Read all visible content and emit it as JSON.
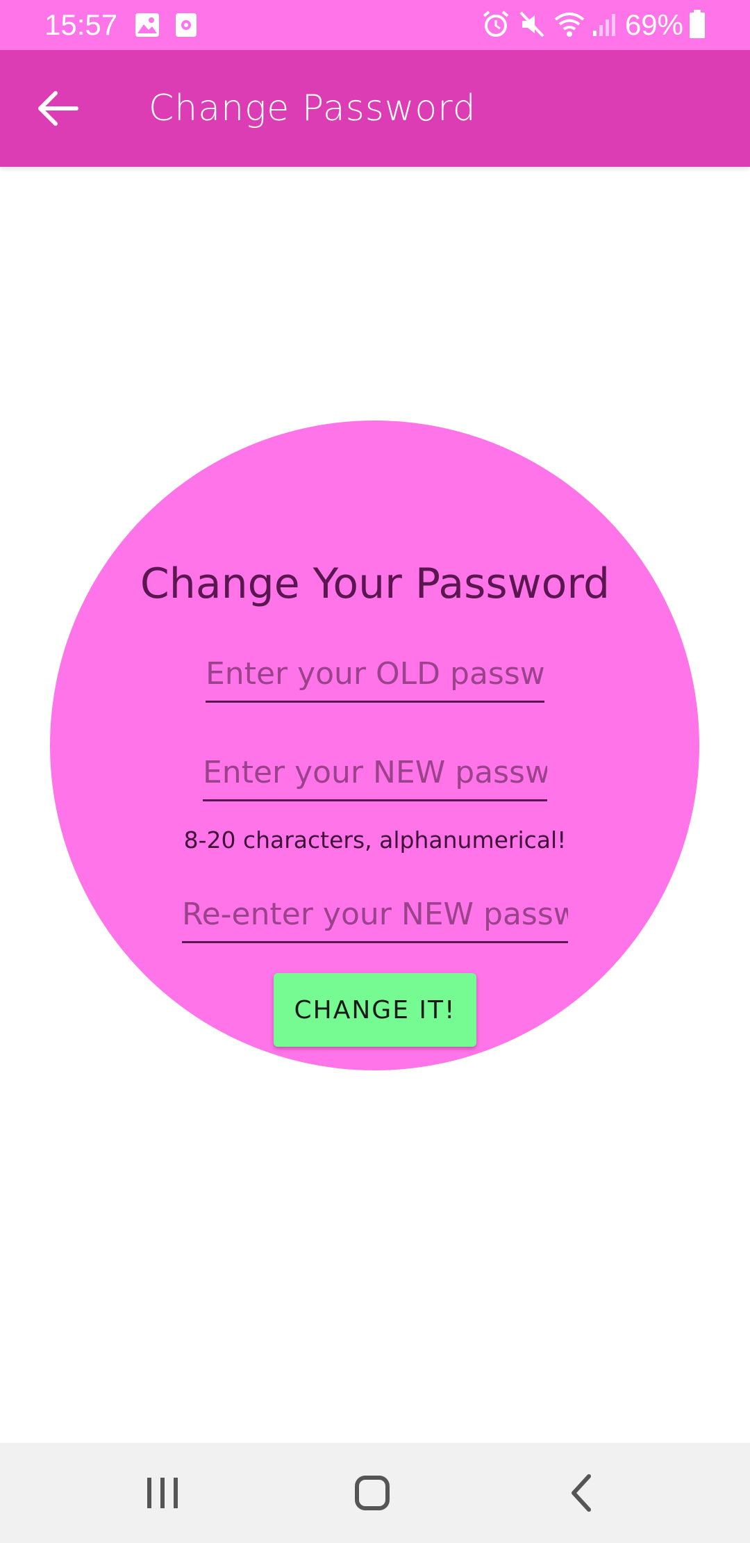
{
  "status_bar": {
    "time": "15:57",
    "battery": "69%",
    "icons": [
      "image-icon",
      "screen-record-icon",
      "alarm-icon",
      "mute-vibrate-icon",
      "wifi-icon",
      "signal-icon",
      "battery-icon"
    ]
  },
  "app_bar": {
    "title": "Change Password",
    "back_icon": "arrow-left-icon"
  },
  "form": {
    "heading": "Change Your Password",
    "old_password_placeholder": "Enter your OLD password",
    "new_password_placeholder": "Enter your NEW password",
    "hint": "8-20 characters, alphanumerical!",
    "confirm_password_placeholder": "Re-enter your NEW password",
    "submit_label": "CHANGE IT!"
  },
  "nav_bar": {
    "icons": [
      "recent-apps-icon",
      "home-icon",
      "back-nav-icon"
    ]
  },
  "colors": {
    "status_bar": "#ff74e8",
    "app_bar": "#dc3cb4",
    "circle": "#ff74e8",
    "button": "#76fa92",
    "text_dark": "#5a1650"
  }
}
